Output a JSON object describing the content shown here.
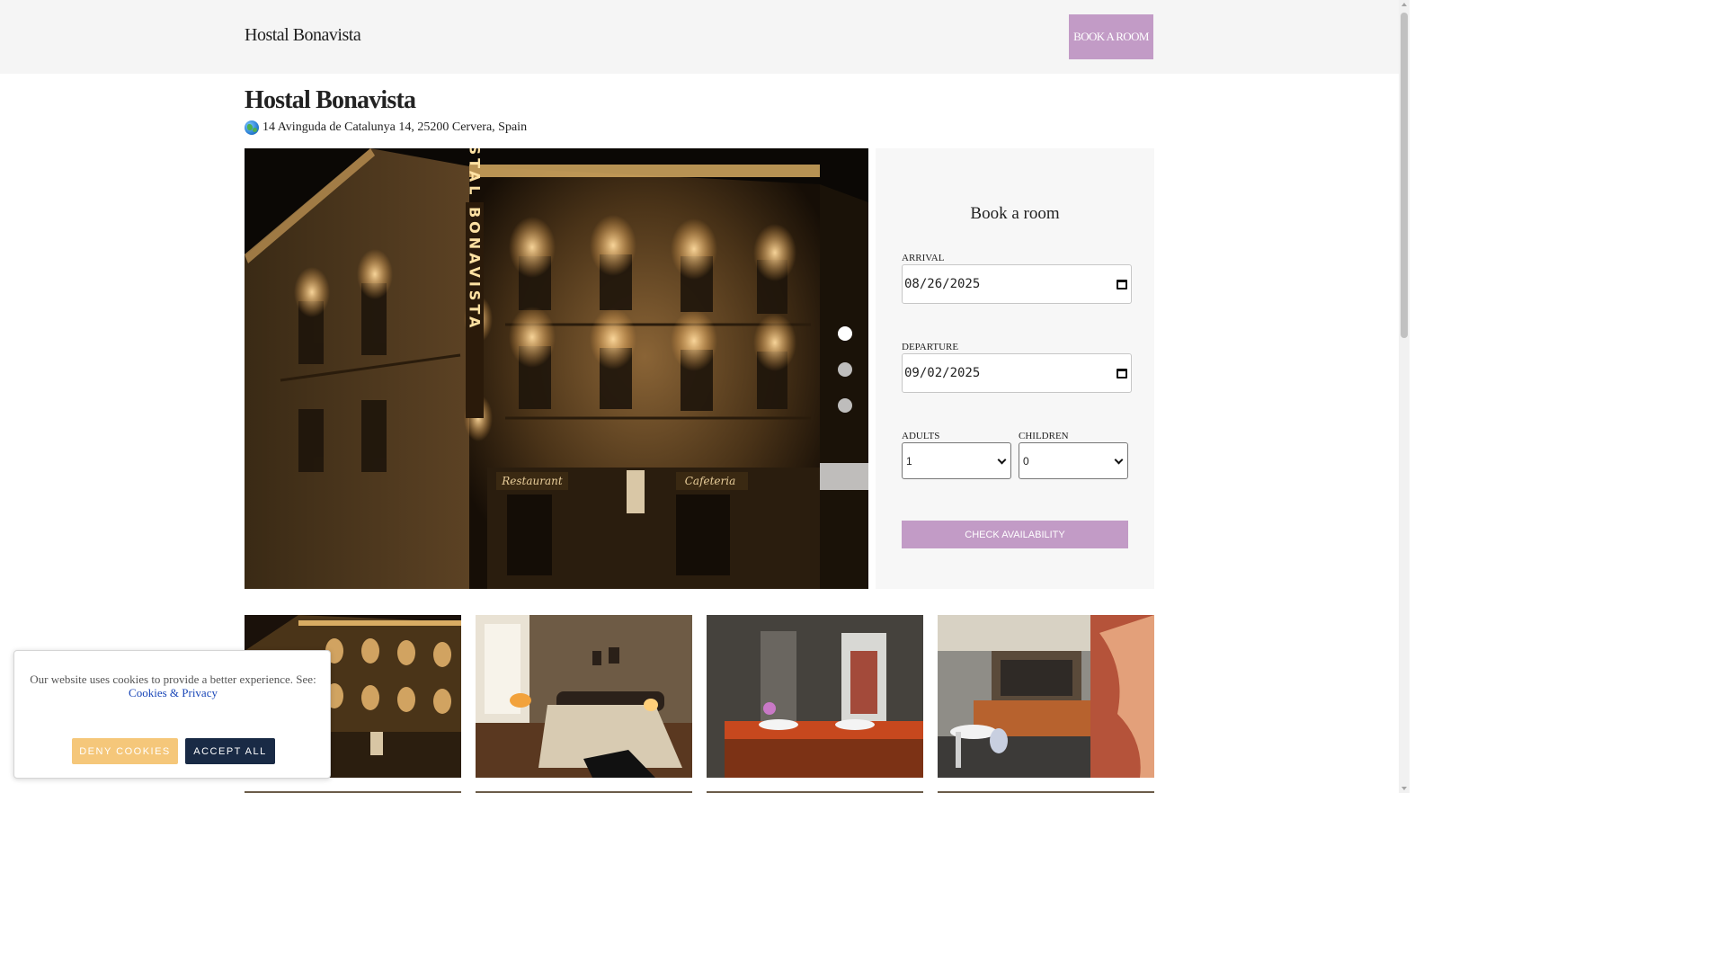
{
  "header": {
    "brand": "Hostal Bonavista",
    "book_button": "BOOK A ROOM"
  },
  "hotel": {
    "name": "Hostal Bonavista",
    "address_icon": "globe-icon",
    "address": "14 Avinguda de Catalunya 14, 25200 Cervera, Spain"
  },
  "hero": {
    "slides_count": 3,
    "active_slide": 1,
    "sign_text": "HOSTAL BONAVISTA",
    "shop_signs": [
      "Restaurant",
      "Cafeteria"
    ]
  },
  "booking": {
    "title": "Book a room",
    "arrival_label": "ARRIVAL",
    "arrival_value": "08/26/2025",
    "departure_label": "DEPARTURE",
    "departure_value": "09/02/2025",
    "adults_label": "ADULTS",
    "adults_value": "1",
    "children_label": "CHILDREN",
    "children_value": "0",
    "check_button": "CHECK AVAILABILITY"
  },
  "gallery": [
    {
      "subject": "Hotel facade at night"
    },
    {
      "subject": "Bedroom with double bed"
    },
    {
      "subject": "Bathroom with double sink"
    },
    {
      "subject": "Bar and cafeteria"
    }
  ],
  "cookie_banner": {
    "message": "Our website uses cookies to provide a better experience. See:",
    "link": "Cookies & Privacy",
    "deny_button": "DENY COOKIES",
    "accept_button": "ACCEPT ALL"
  },
  "colors": {
    "accent": "#c29bc6",
    "deny": "#f5c77a",
    "accept": "#192a45"
  }
}
